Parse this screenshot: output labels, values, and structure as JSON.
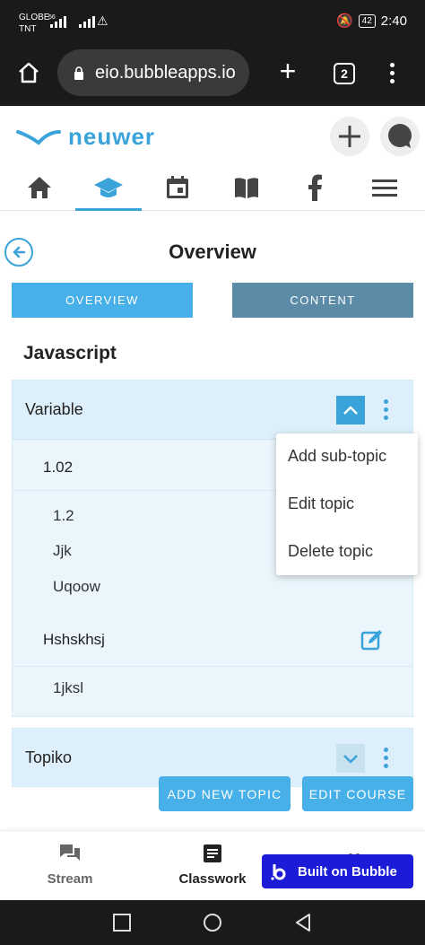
{
  "status_bar": {
    "carrier_line1": "GLOBE",
    "carrier_line2": "TNT",
    "network": "56",
    "battery": "42",
    "time": "2:40"
  },
  "browser": {
    "url": "eio.bubbleapps.io",
    "tab_count": "2"
  },
  "app": {
    "logo_text": "neuwer",
    "brand_color": "#3aa3d9"
  },
  "nav_tabs": [
    {
      "icon": "home-icon",
      "active": false
    },
    {
      "icon": "graduation-cap-icon",
      "active": true
    },
    {
      "icon": "calendar-icon",
      "active": false
    },
    {
      "icon": "book-icon",
      "active": false
    },
    {
      "icon": "facebook-icon",
      "active": false
    },
    {
      "icon": "hamburger-menu-icon",
      "active": false
    }
  ],
  "page": {
    "title": "Overview",
    "tab_overview": "OVERVIEW",
    "tab_content": "CONTENT",
    "course_title": "Javascript"
  },
  "topics": [
    {
      "name": "Variable",
      "expanded": true,
      "subtopics": [
        {
          "name": "1.02",
          "items": [
            "1.2",
            "Jjk",
            "Uqoow"
          ]
        },
        {
          "name": "Hshskhsj",
          "items": [
            "1jksl"
          ]
        }
      ]
    },
    {
      "name": "Topiko",
      "expanded": false
    }
  ],
  "dropdown": {
    "items": [
      "Add sub-topic",
      "Edit topic",
      "Delete topic"
    ]
  },
  "actions": {
    "add_topic": "ADD NEW TOPIC",
    "edit_course": "EDIT COURSE"
  },
  "bottom_nav": {
    "stream": "Stream",
    "classwork": "Classwork",
    "bubble_badge": "Built on Bubble"
  }
}
